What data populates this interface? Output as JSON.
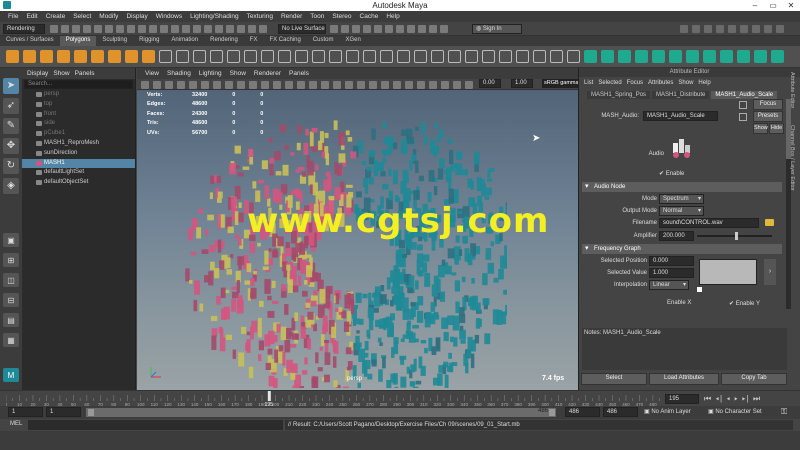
{
  "window": {
    "title": "Autodesk Maya"
  },
  "menus": [
    "File",
    "Edit",
    "Create",
    "Select",
    "Modify",
    "Display",
    "Windows",
    "Lighting/Shading",
    "Texturing",
    "Render",
    "Toon",
    "Stereo",
    "Cache",
    "Help"
  ],
  "status": {
    "mode": "Rendering",
    "live_surface": "No Live Surface",
    "sign_in": "Sign In"
  },
  "shelf_tabs": [
    "Curves / Surfaces",
    "Polygons",
    "Sculpting",
    "Rigging",
    "Animation",
    "Rendering",
    "FX",
    "FX Caching",
    "Custom",
    "XGen"
  ],
  "outliner": {
    "menu": [
      "Display",
      "Show",
      "Panels"
    ],
    "search_placeholder": "Search...",
    "items": [
      {
        "label": "persp",
        "dim": true
      },
      {
        "label": "top",
        "dim": true
      },
      {
        "label": "front",
        "dim": true
      },
      {
        "label": "side",
        "dim": true
      },
      {
        "label": "pCube1",
        "dim": true
      },
      {
        "label": "MASH1_ReproMesh",
        "dim": false
      },
      {
        "label": "sunDirection",
        "dim": false
      },
      {
        "label": "MASH1",
        "dim": false,
        "selected": true
      },
      {
        "label": "defaultLightSet",
        "dim": false
      },
      {
        "label": "defaultObjectSet",
        "dim": false
      }
    ]
  },
  "viewport": {
    "menu": [
      "View",
      "Shading",
      "Lighting",
      "Show",
      "Renderer",
      "Panels"
    ],
    "exposure": "0.00",
    "gamma": "1.00",
    "color_space": "sRGB gamma",
    "hud": [
      {
        "label": "Verts:",
        "a": "32400",
        "b": "0",
        "c": "0"
      },
      {
        "label": "Edges:",
        "a": "48600",
        "b": "0",
        "c": "0"
      },
      {
        "label": "Faces:",
        "a": "24300",
        "b": "0",
        "c": "0"
      },
      {
        "label": "Tris:",
        "a": "48600",
        "b": "0",
        "c": "0"
      },
      {
        "label": "UVs:",
        "a": "56700",
        "b": "0",
        "c": "0"
      }
    ],
    "camera": "persp",
    "fps": "7.4 fps",
    "watermark": "www.cgtsj.com"
  },
  "attribute_editor": {
    "title": "Attribute Editor",
    "menu": [
      "List",
      "Selected",
      "Focus",
      "Attributes",
      "Show",
      "Help"
    ],
    "tabs": [
      "MASH1_Spring_Pos",
      "MASH1_Distribute",
      "MASH1_Audio_Scale"
    ],
    "node_label": "MASH_Audio:",
    "node_value": "MASH1_Audio_Scale",
    "focus_btn": "Focus",
    "presets_btn": "Presets",
    "show_btn": "Show",
    "hide_btn": "Hide",
    "audio_label": "Audio",
    "enable_label": "Enable",
    "section_audio": "Audio Node",
    "mode_label": "Mode",
    "mode_value": "Spectrum",
    "output_label": "Output Mode",
    "output_value": "Normal",
    "filename_label": "Filename",
    "filename_value": "sound\\CONTROL.wav",
    "amplifier_label": "Amplifier",
    "amplifier_value": "200.000",
    "section_freq": "Frequency Graph",
    "selpos_label": "Selected Position",
    "selpos_value": "0.000",
    "selval_label": "Selected Value",
    "selval_value": "1.000",
    "interp_label": "Interpolation",
    "interp_value": "Linear",
    "enable_x": "Enable X",
    "enable_y": "Enable Y",
    "notes": "Notes:  MASH1_Audio_Scale",
    "select_btn": "Select",
    "load_btn": "Load Attributes",
    "copy_btn": "Copy Tab",
    "side_tabs": [
      "Attribute Editor",
      "Channel Box / Layer Editor"
    ]
  },
  "timeline": {
    "ticks": [
      "0",
      "5",
      "10",
      "15",
      "20",
      "25",
      "30",
      "35",
      "40",
      "45",
      "50",
      "55",
      "60",
      "65",
      "70",
      "75",
      "80",
      "85",
      "90",
      "95",
      "100",
      "105",
      "110",
      "115",
      "120",
      "125",
      "130",
      "135",
      "140",
      "145",
      "150",
      "155",
      "160",
      "165",
      "170",
      "175",
      "180",
      "185",
      "190",
      "195",
      "200",
      "205",
      "210",
      "215",
      "220",
      "225",
      "230",
      "235",
      "240",
      "245",
      "250",
      "255",
      "260",
      "265",
      "270",
      "275",
      "280",
      "285",
      "290",
      "295",
      "300",
      "305",
      "310",
      "315",
      "320",
      "325",
      "330",
      "335",
      "340",
      "345",
      "350",
      "355",
      "360",
      "365",
      "370",
      "375",
      "380",
      "385",
      "390",
      "395",
      "400",
      "405",
      "410",
      "415",
      "420",
      "425",
      "430",
      "435",
      "440",
      "445",
      "450",
      "455",
      "460",
      "465",
      "470",
      "475",
      "480",
      "485"
    ],
    "current": "195",
    "current_field": "195",
    "range_start": "1",
    "range_start2": "1",
    "range_end": "486",
    "range_end2": "486",
    "range_end3": "486",
    "anim_layer": "No Anim Layer",
    "char_set": "No Character Set"
  },
  "mel": {
    "label": "MEL",
    "result": "// Result: C:/Users/Scott Pagano/Desktop/Exercise Files/Ch 09/scenes/09_01_Start.mb"
  },
  "colors": {
    "accent": "#5285a6",
    "teal": "#1f8a97",
    "pink": "#d3557f",
    "yellow": "#c8c05a",
    "orange": "#e0922b",
    "watermark": "#f3ef22"
  }
}
